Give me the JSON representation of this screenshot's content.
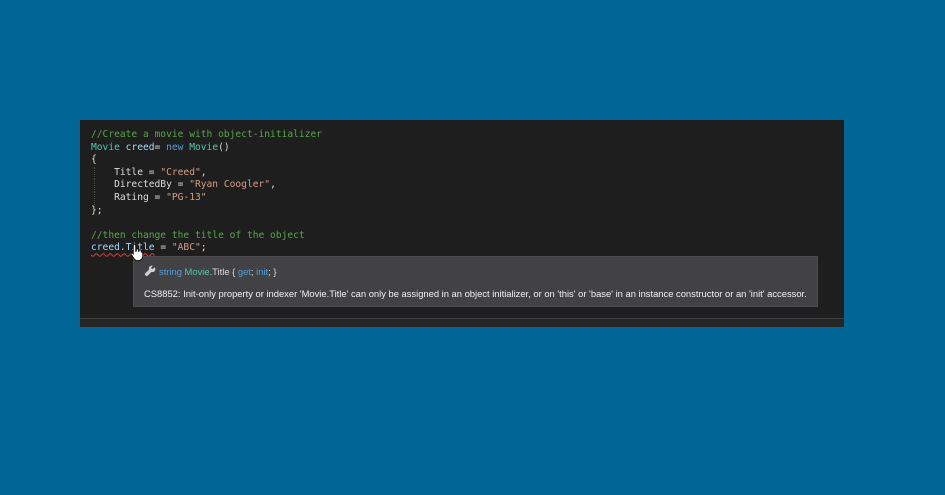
{
  "editor": {
    "code_lines": [
      {
        "parts": [
          {
            "t": "//Create a movie with object-initializer",
            "c": "cmt"
          }
        ]
      },
      {
        "parts": [
          {
            "t": "Movie",
            "c": "typ"
          },
          {
            "t": " creed",
            "c": "var"
          },
          {
            "t": "= ",
            "c": "plain"
          },
          {
            "t": "new",
            "c": "kw"
          },
          {
            "t": " ",
            "c": "plain"
          },
          {
            "t": "Movie",
            "c": "typ"
          },
          {
            "t": "()",
            "c": "plain"
          }
        ]
      },
      {
        "parts": [
          {
            "t": "{",
            "c": "plain"
          }
        ]
      },
      {
        "guide": true,
        "parts": [
          {
            "t": "    Title = ",
            "c": "plain"
          },
          {
            "t": "\"Creed\"",
            "c": "str"
          },
          {
            "t": ",",
            "c": "plain"
          }
        ]
      },
      {
        "guide": true,
        "parts": [
          {
            "t": "    DirectedBy = ",
            "c": "plain"
          },
          {
            "t": "\"Ryan Coogler\"",
            "c": "str"
          },
          {
            "t": ",",
            "c": "plain"
          }
        ]
      },
      {
        "guide": true,
        "parts": [
          {
            "t": "    Rating = ",
            "c": "plain"
          },
          {
            "t": "\"PG-13\"",
            "c": "str"
          }
        ]
      },
      {
        "parts": [
          {
            "t": "};",
            "c": "plain"
          }
        ]
      },
      {
        "parts": [
          {
            "t": "",
            "c": "plain"
          }
        ]
      },
      {
        "parts": [
          {
            "t": "//then change the title of the object",
            "c": "cmt"
          }
        ]
      },
      {
        "parts": [
          {
            "t": "creed.Title",
            "c": "var",
            "squiggle": true
          },
          {
            "t": " = ",
            "c": "plain"
          },
          {
            "t": "\"ABC\"",
            "c": "str"
          },
          {
            "t": ";",
            "c": "plain"
          }
        ]
      }
    ]
  },
  "tooltip": {
    "signature": {
      "type_keyword": "string",
      "class_name": "Movie",
      "member": ".Title { ",
      "get_kw": "get",
      "sep": "; ",
      "init_kw": "init",
      "end": "; }"
    },
    "message": "CS8852: Init-only property or indexer 'Movie.Title' can only be assigned in an object initializer, or on 'this' or 'base' in an instance constructor or an 'init' accessor."
  },
  "icons": {
    "wrench": "wrench-icon",
    "cursor": "hand-cursor-icon"
  },
  "colors": {
    "background": "#016696",
    "editor": "#1e1e1e",
    "tooltip": "#424245",
    "error": "#e04040"
  }
}
